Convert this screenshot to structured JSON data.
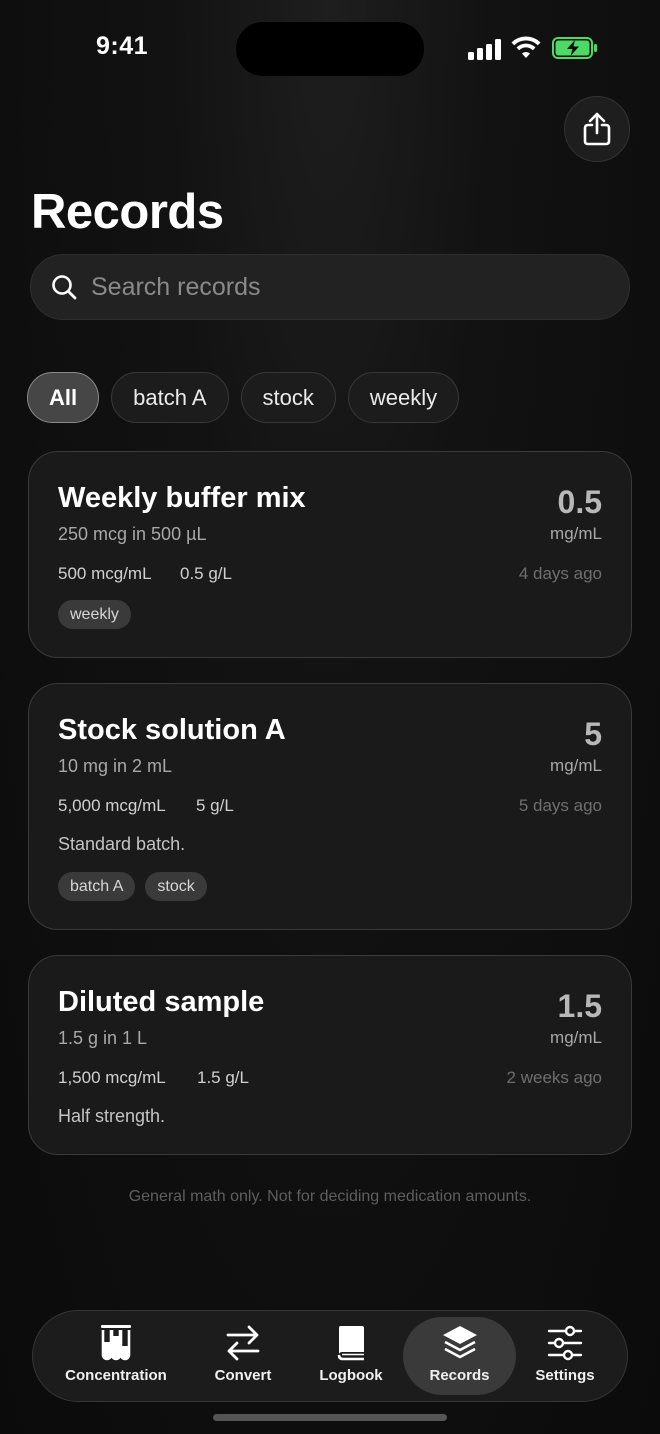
{
  "status_bar": {
    "time": "9:41"
  },
  "header": {
    "title": "Records"
  },
  "search": {
    "placeholder": "Search records"
  },
  "filters": [
    "All",
    "batch A",
    "stock",
    "weekly"
  ],
  "records": [
    {
      "name": "Weekly buffer mix",
      "amount": "250 mcg in 500 µL",
      "value": "0.5",
      "unit": "mg/mL",
      "conv_mcg": "500 mcg/mL",
      "conv_g": "0.5 g/L",
      "age": "4 days ago",
      "note": "",
      "tags": [
        "weekly"
      ]
    },
    {
      "name": "Stock solution A",
      "amount": "10 mg in 2 mL",
      "value": "5",
      "unit": "mg/mL",
      "conv_mcg": "5,000 mcg/mL",
      "conv_g": "5 g/L",
      "age": "5 days ago",
      "note": "Standard batch.",
      "tags": [
        "batch A",
        "stock"
      ]
    },
    {
      "name": "Diluted sample",
      "amount": "1.5 g in 1 L",
      "value": "1.5",
      "unit": "mg/mL",
      "conv_mcg": "1,500 mcg/mL",
      "conv_g": "1.5 g/L",
      "age": "2 weeks ago",
      "note": "Half strength.",
      "tags": []
    }
  ],
  "disclaimer": "General math only. Not for deciding medication amounts.",
  "tabbar": {
    "items": [
      {
        "label": "Concentration",
        "icon": "test-tubes-icon"
      },
      {
        "label": "Convert",
        "icon": "arrows-swap-icon"
      },
      {
        "label": "Logbook",
        "icon": "book-icon"
      },
      {
        "label": "Records",
        "icon": "layers-icon"
      },
      {
        "label": "Settings",
        "icon": "sliders-icon"
      }
    ],
    "active": "Records"
  },
  "colors": {
    "background": "#0b0b0b",
    "card": "#1a1a1a",
    "accent_active": "#3a3a3a",
    "battery_charge": "#4cd964"
  }
}
